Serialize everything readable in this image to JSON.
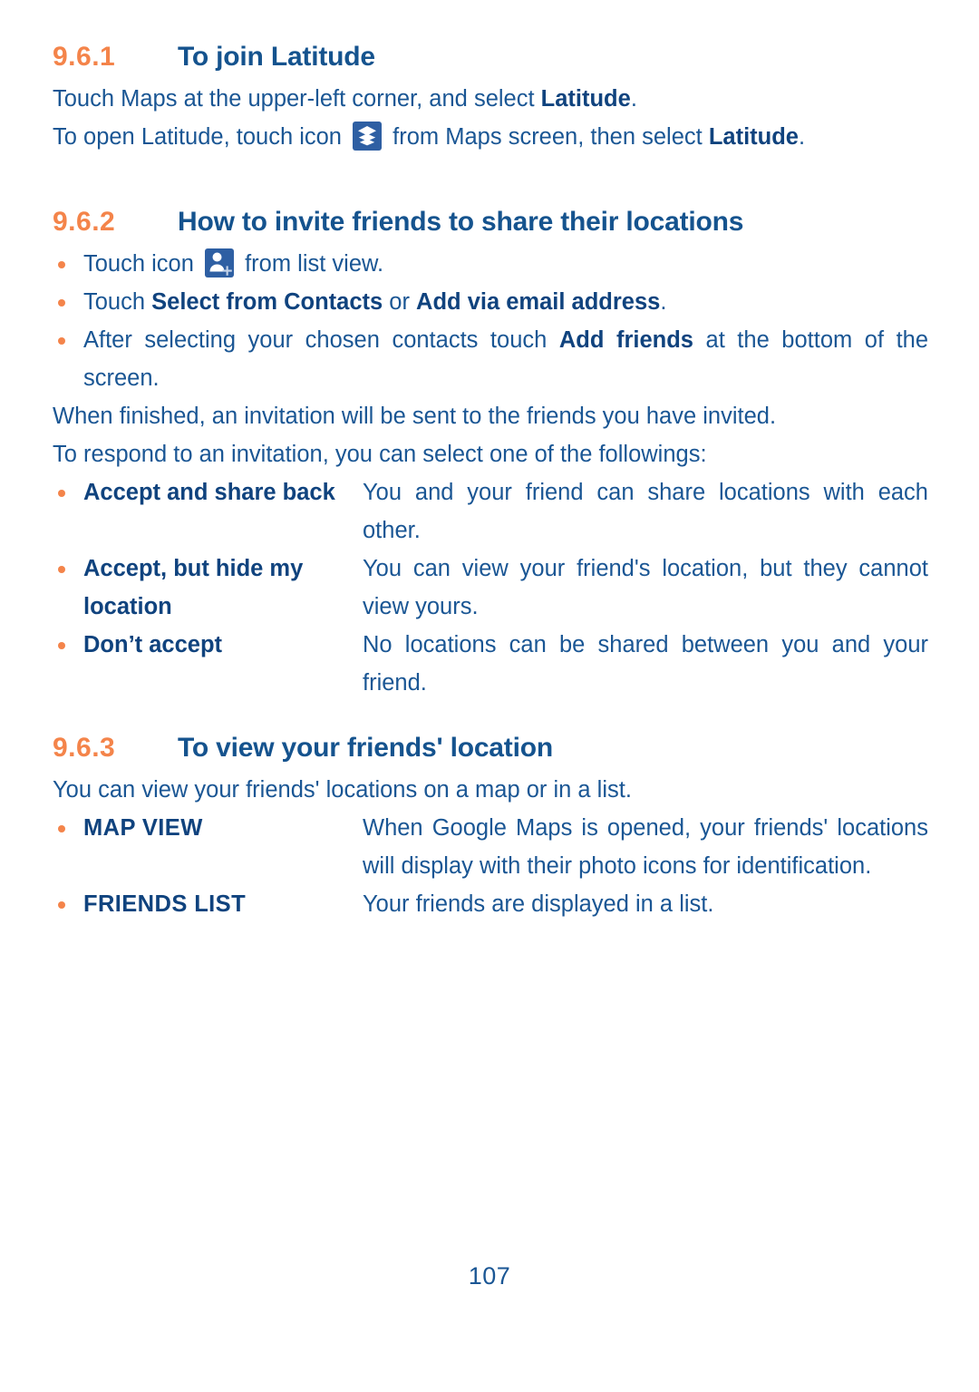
{
  "colors": {
    "heading_number": "#F4844A",
    "heading_text": "#15538E",
    "body_text": "#1A5694",
    "bold_text": "#10437E",
    "bullet": "#F4844A",
    "icon_bg": "#2E5FA3",
    "page_background": "#ffffff"
  },
  "sections": [
    {
      "number": "9.6.1",
      "title": "To join Latitude",
      "para1": {
        "t1": "Touch Maps at the upper-left corner, and select ",
        "b1": "Latitude",
        "t2": "."
      },
      "para2": {
        "t1": "To open Latitude, touch icon ",
        "icon": "layers-icon",
        "t2": " from Maps screen, then select ",
        "b1": "Latitude",
        "t3": "."
      }
    },
    {
      "number": "9.6.2",
      "title": "How to invite friends to share their locations",
      "bullets": [
        {
          "t1": "Touch icon ",
          "icon": "add-person-icon",
          "t2": " from list view."
        },
        {
          "t1": "Touch ",
          "b1": "Select from Contacts",
          "t2": " or ",
          "b2": "Add via email address",
          "t3": "."
        },
        {
          "t1": "After selecting your chosen contacts touch ",
          "b1": "Add friends",
          "t2": " at the bottom of the screen."
        }
      ],
      "para1": "When finished, an invitation will be sent to the friends you have invited.",
      "para2": "To respond to an invitation, you can select one of the followings:",
      "definitions": [
        {
          "term": "Accept and share back",
          "desc": "You and your friend can share locations with each other."
        },
        {
          "term": "Accept, but hide my location",
          "desc": "You can view your friend's location, but they cannot view yours."
        },
        {
          "term": "Don’t accept",
          "desc": "No locations can be shared between you and your friend."
        }
      ]
    },
    {
      "number": "9.6.3",
      "title": "To view your friends' location",
      "para1": "You can view your friends' locations on a map or in a list.",
      "definitions": [
        {
          "term": "MAP VIEW",
          "desc": "When Google Maps is opened, your friends' locations will display with their photo icons for identification."
        },
        {
          "term": "FRIENDS LIST",
          "desc": "Your friends are displayed in a list."
        }
      ]
    }
  ],
  "footer": {
    "page_number": "107"
  }
}
